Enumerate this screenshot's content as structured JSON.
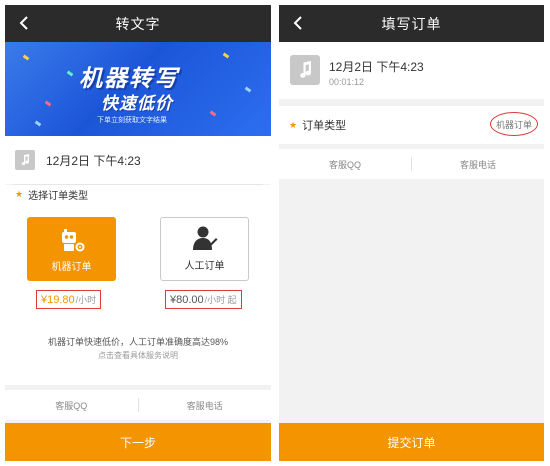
{
  "left_screen": {
    "title": "转文字",
    "banner": {
      "title": "机器转写",
      "subtitle": "快速低价",
      "caption": "下单立刻获取文字结果"
    },
    "audio": {
      "date": "12月2日 下午4:23"
    },
    "order_type_label": "选择订单类型",
    "options": [
      {
        "label": "机器订单",
        "price": "¥19.80",
        "unit": "/小时"
      },
      {
        "label": "人工订单",
        "price": "¥80.00",
        "unit": "/小时 起"
      }
    ],
    "description": "机器订单快速低价，人工订单准确度高达98%",
    "description_link": "点击查看具体服务说明",
    "contact": {
      "qq": "客服QQ",
      "phone": "客服电话"
    },
    "cta": "下一步"
  },
  "right_screen": {
    "title": "填写订单",
    "audio": {
      "date": "12月2日 下午4:23",
      "duration": "00:01:12"
    },
    "order_type_label": "订单类型",
    "order_type_value": "机器订单",
    "contact": {
      "qq": "客服QQ",
      "phone": "客服电话"
    },
    "cta": "提交订单"
  },
  "colors": {
    "accent": "#f39400",
    "title_bar": "#2b2b2b",
    "highlight": "#e03a3a",
    "banner": "#2d6ef0"
  },
  "icons": [
    "back-icon",
    "music-note-icon",
    "robot-icon",
    "person-icon",
    "star-icon"
  ]
}
